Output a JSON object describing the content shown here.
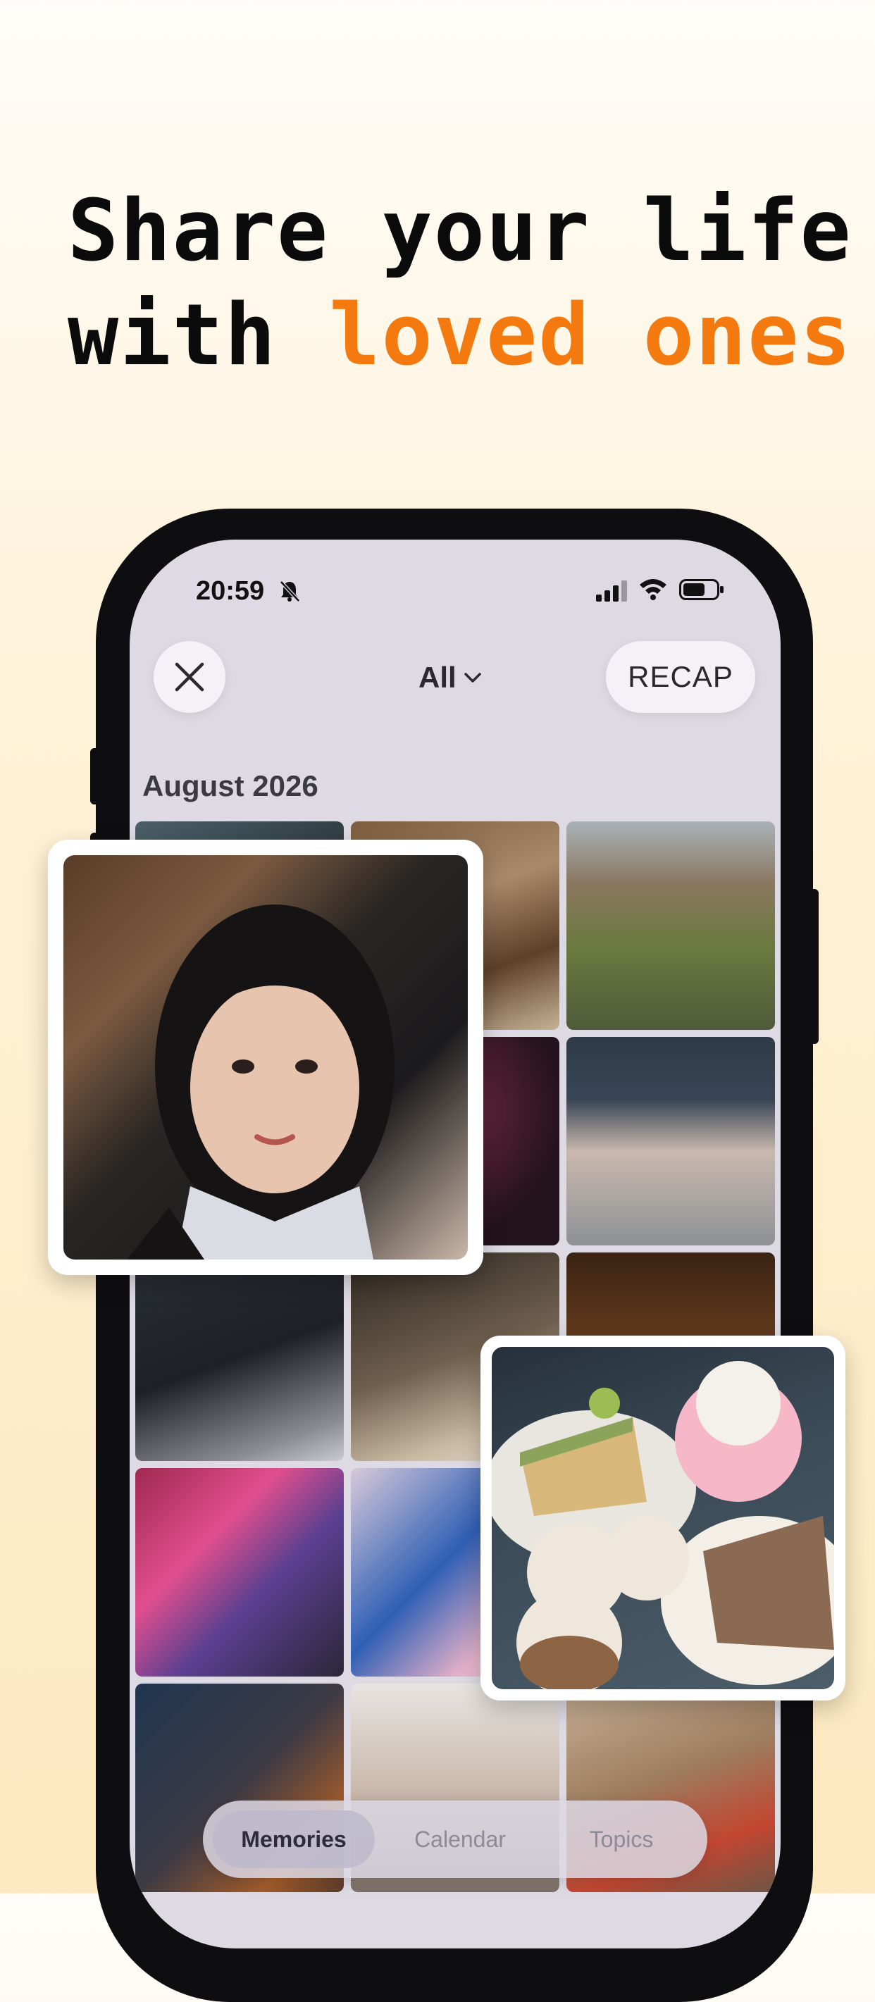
{
  "headline": {
    "line1": "Share your life",
    "line2_prefix": "with ",
    "line2_accent": "loved ones",
    "accent_color": "#f47a10"
  },
  "status_bar": {
    "time": "20:59",
    "icons": [
      "bell-slash-icon",
      "signal-icon",
      "wifi-icon",
      "battery-icon"
    ]
  },
  "top_bar": {
    "close_icon": "close-icon",
    "filter_label": "All",
    "filter_icon": "chevron-down-icon",
    "recap_label": "RECAP"
  },
  "gallery": {
    "month_label": "August 2026"
  },
  "tab_bar": {
    "tabs": [
      {
        "label": "Memories",
        "active": true
      },
      {
        "label": "Calendar",
        "active": false
      },
      {
        "label": "Topics",
        "active": false
      }
    ]
  }
}
